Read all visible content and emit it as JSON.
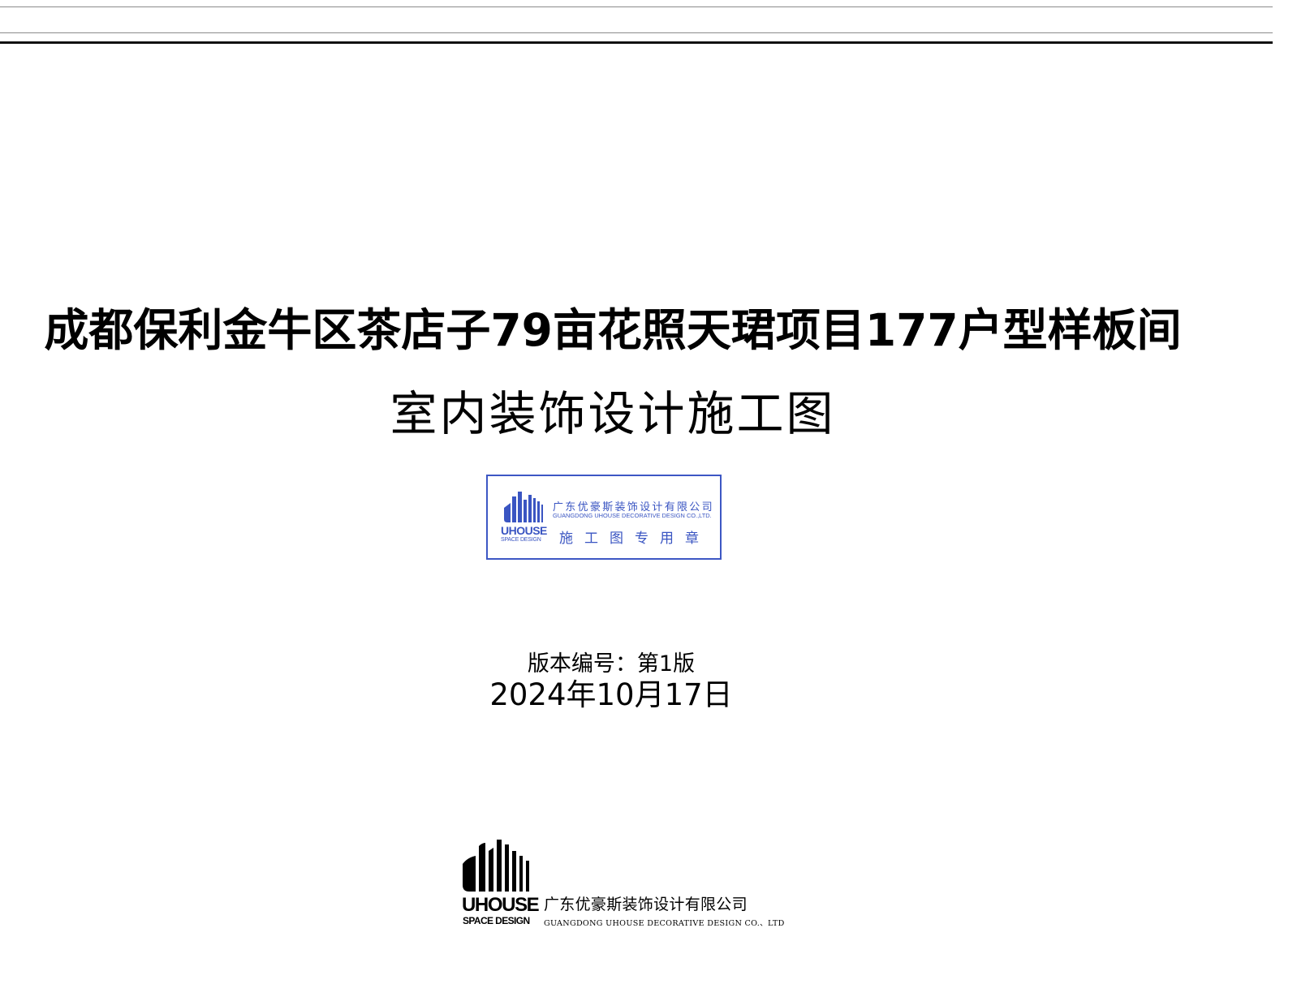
{
  "title": {
    "line1": "成都保利金牛区茶店子79亩花照天珺项目177户型样板间",
    "line2": "室内装饰设计施工图"
  },
  "stamp": {
    "brand": "UHOUSE",
    "brand_sub": "SPACE DESIGN",
    "company_cn": "广东优豪斯装饰设计有限公司",
    "company_en": "GUANGDONG UHOUSE DECORATIVE DESIGN CO.,LTD.",
    "seal_text": "施工图专用章",
    "color": "#3a55c2"
  },
  "version": "版本编号：第1版",
  "date": "2024年10月17日",
  "footer": {
    "brand": "UHOUSE",
    "brand_sub": "SPACE DESIGN",
    "company_cn": "广东优豪斯装饰设计有限公司",
    "company_en": "GUANGDONG UHOUSE DECORATIVE DESIGN CO.、LTD"
  }
}
